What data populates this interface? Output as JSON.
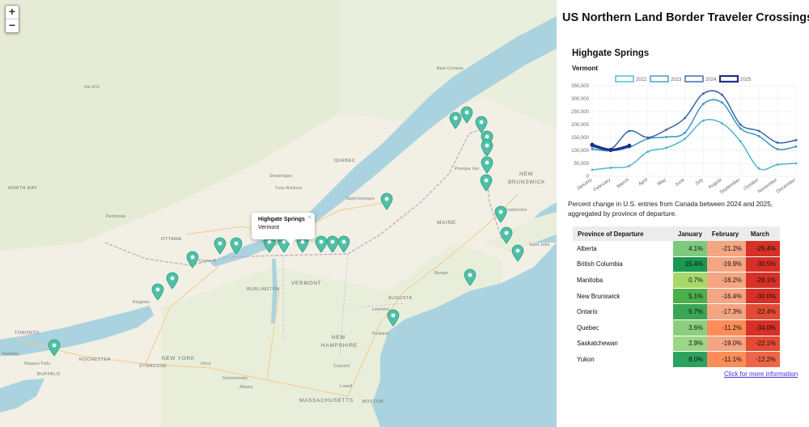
{
  "map": {
    "zoom_in": "+",
    "zoom_out": "−",
    "popup": {
      "title": "Highgate Springs",
      "subtitle": "Vermont",
      "close": "×"
    },
    "labels": [
      {
        "t": "NORTH BAY",
        "c": "",
        "l": 10,
        "tp": 230
      },
      {
        "t": "Pembroke",
        "c": "city",
        "l": 131,
        "tp": 265
      },
      {
        "t": "OTTAWA",
        "c": "",
        "l": 199,
        "tp": 293
      },
      {
        "t": "Cornwall",
        "c": "city",
        "l": 246,
        "tp": 320
      },
      {
        "t": "Kingston",
        "c": "city",
        "l": 164,
        "tp": 371
      },
      {
        "t": "TORONTO",
        "c": "",
        "l": 18,
        "tp": 409
      },
      {
        "t": "Hamilton",
        "c": "city",
        "l": 2,
        "tp": 435
      },
      {
        "t": "Niagara Falls",
        "c": "city",
        "l": 30,
        "tp": 447
      },
      {
        "t": "BUFFALO",
        "c": "",
        "l": 46,
        "tp": 460
      },
      {
        "t": "ROCHESTER",
        "c": "",
        "l": 98,
        "tp": 442
      },
      {
        "t": "SYRACUSE",
        "c": "",
        "l": 172,
        "tp": 450
      },
      {
        "t": "NEW YORK",
        "c": "state",
        "l": 200,
        "tp": 440
      },
      {
        "t": "Utica",
        "c": "city",
        "l": 248,
        "tp": 447
      },
      {
        "t": "Schenectady",
        "c": "city",
        "l": 275,
        "tp": 465
      },
      {
        "t": "Albany",
        "c": "city",
        "l": 296,
        "tp": 476
      },
      {
        "t": "BURLINGTON",
        "c": "",
        "l": 305,
        "tp": 355
      },
      {
        "t": "VERMONT",
        "c": "state",
        "l": 360,
        "tp": 347
      },
      {
        "t": "NEW",
        "c": "state",
        "l": 410,
        "tp": 414
      },
      {
        "t": "HAMPSHIRE",
        "c": "state",
        "l": 397,
        "tp": 424
      },
      {
        "t": "Concord",
        "c": "city",
        "l": 412,
        "tp": 450
      },
      {
        "t": "Lowell",
        "c": "city",
        "l": 420,
        "tp": 475
      },
      {
        "t": "MASSACHUSETTS",
        "c": "state",
        "l": 370,
        "tp": 492
      },
      {
        "t": "BOSTON",
        "c": "",
        "l": 448,
        "tp": 494
      },
      {
        "t": "Portland",
        "c": "city",
        "l": 460,
        "tp": 410
      },
      {
        "t": "Lewiston",
        "c": "city",
        "l": 460,
        "tp": 380
      },
      {
        "t": "AUGUSTA",
        "c": "",
        "l": 480,
        "tp": 366
      },
      {
        "t": "Bangor",
        "c": "city",
        "l": 537,
        "tp": 335
      },
      {
        "t": "MAINE",
        "c": "state",
        "l": 540,
        "tp": 272
      },
      {
        "t": "QUÉBEC",
        "c": "",
        "l": 413,
        "tp": 196
      },
      {
        "t": "Saint-Georges",
        "c": "city",
        "l": 428,
        "tp": 243
      },
      {
        "t": "Trois-Rivières",
        "c": "city",
        "l": 340,
        "tp": 230
      },
      {
        "t": "Shawinigan",
        "c": "city",
        "l": 333,
        "tp": 215
      },
      {
        "t": "Presque Isle",
        "c": "city",
        "l": 562,
        "tp": 206
      },
      {
        "t": "NEW",
        "c": "state",
        "l": 642,
        "tp": 212
      },
      {
        "t": "BRUNSWICK",
        "c": "state",
        "l": 628,
        "tp": 222
      },
      {
        "t": "Fredericton",
        "c": "city",
        "l": 624,
        "tp": 257
      },
      {
        "t": "Saint John",
        "c": "city",
        "l": 654,
        "tp": 300
      },
      {
        "t": "Val-d'Or",
        "c": "city",
        "l": 104,
        "tp": 105
      },
      {
        "t": "Baie-Comeau",
        "c": "city",
        "l": 540,
        "tp": 82
      }
    ]
  },
  "title": "US Northern Land Border Traveler Crossings",
  "station": "Highgate Springs",
  "state": "Vermont",
  "description": "Percent change in U.S. entries from Canada between 2024 and 2025, aggregated by province of departure.",
  "table": {
    "headers": [
      "Province of Departure",
      "January",
      "February",
      "March"
    ],
    "rows": [
      {
        "province": "Alberta",
        "jan": "4.1%",
        "feb": "-21.2%",
        "mar": "-26.4%"
      },
      {
        "province": "British Columbia",
        "jan": "15.4%",
        "feb": "-19.9%",
        "mar": "-30.5%"
      },
      {
        "province": "Manitoba",
        "jan": "0.7%",
        "feb": "-18.2%",
        "mar": "-28.1%"
      },
      {
        "province": "New Brunswick",
        "jan": "5.1%",
        "feb": "-16.4%",
        "mar": "-30.0%"
      },
      {
        "province": "Ontario",
        "jan": "5.7%",
        "feb": "-17.3%",
        "mar": "-22.4%"
      },
      {
        "province": "Quebec",
        "jan": "3.6%",
        "feb": "-11.2%",
        "mar": "-34.0%"
      },
      {
        "province": "Saskatchewan",
        "jan": "2.9%",
        "feb": "-19.0%",
        "mar": "-22.1%"
      },
      {
        "province": "Yukon",
        "jan": "8.0%",
        "feb": "-11.1%",
        "mar": "-12.2%"
      }
    ],
    "colors": {
      "Alberta": [
        "#7fc97f",
        "#f4a582",
        "#d73027"
      ],
      "British Columbia": [
        "#1a9850",
        "#f4a582",
        "#d73027"
      ],
      "Manitoba": [
        "#a6d96a",
        "#f4a582",
        "#d73027"
      ],
      "New Brunswick": [
        "#4daf4a",
        "#f4a582",
        "#d73027"
      ],
      "Ontario": [
        "#3aa655",
        "#f4a582",
        "#e34a33"
      ],
      "Quebec": [
        "#8ccf7e",
        "#fc8d59",
        "#d73027"
      ],
      "Saskatchewan": [
        "#9bd684",
        "#f4a582",
        "#e34a33"
      ],
      "Yukon": [
        "#2ca25f",
        "#fc8d59",
        "#ef6548"
      ]
    }
  },
  "more_link": "Click for more information",
  "chart_data": {
    "type": "line",
    "categories": [
      "January",
      "February",
      "March",
      "April",
      "May",
      "June",
      "July",
      "August",
      "September",
      "October",
      "November",
      "December"
    ],
    "ylim": [
      0,
      350000
    ],
    "yticks": [
      "0",
      "50,000",
      "100,000",
      "150,000",
      "200,000",
      "250,000",
      "300,000",
      "350,000"
    ],
    "series": [
      {
        "name": "2022",
        "color": "#4bb8c9",
        "values": [
          25000,
          33000,
          40000,
          95000,
          110000,
          145000,
          215000,
          205000,
          135000,
          30000,
          45000,
          50000
        ]
      },
      {
        "name": "2023",
        "color": "#3d96c0",
        "values": [
          105000,
          98000,
          112000,
          145000,
          152000,
          168000,
          280000,
          285000,
          185000,
          155000,
          105000,
          115000
        ]
      },
      {
        "name": "2024",
        "color": "#3763a8",
        "values": [
          115000,
          105000,
          175000,
          150000,
          180000,
          225000,
          320000,
          315000,
          200000,
          175000,
          130000,
          140000
        ]
      },
      {
        "name": "2025",
        "color": "#1d2f86",
        "values": [
          122000,
          102000,
          118000
        ]
      }
    ]
  }
}
